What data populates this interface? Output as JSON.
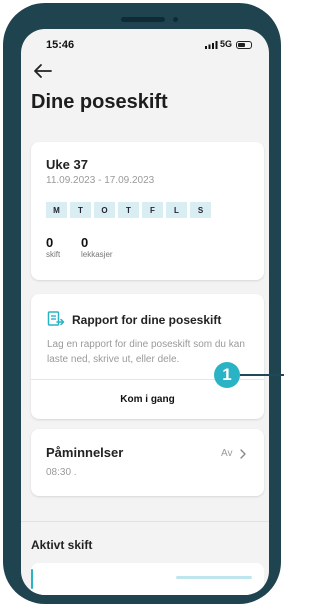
{
  "status_bar": {
    "time": "15:46",
    "network": "5G",
    "battery_level": 0.55
  },
  "page": {
    "title": "Dine poseskift"
  },
  "week_card": {
    "title": "Uke 37",
    "dates": "11.09.2023 - 17.09.2023",
    "days": [
      "M",
      "T",
      "O",
      "T",
      "F",
      "L",
      "S"
    ],
    "stats": [
      {
        "value": "0",
        "label": "skift"
      },
      {
        "value": "0",
        "label": "lekkasjer"
      }
    ]
  },
  "report_card": {
    "icon": "report-icon",
    "title": "Rapport for dine poseskift",
    "description": "Lag en rapport for dine poseskift som du kan laste ned, skrive ut, eller dele.",
    "button_label": "Kom i gang"
  },
  "reminder_card": {
    "title": "Påminnelser",
    "time": "08:30 .",
    "status": "Av"
  },
  "active_section": {
    "title": "Aktivt skift"
  },
  "callout": {
    "number": "1"
  },
  "colors": {
    "frame": "#1f4450",
    "accent": "#2ab3c4",
    "day_chip": "#d8eef3"
  }
}
